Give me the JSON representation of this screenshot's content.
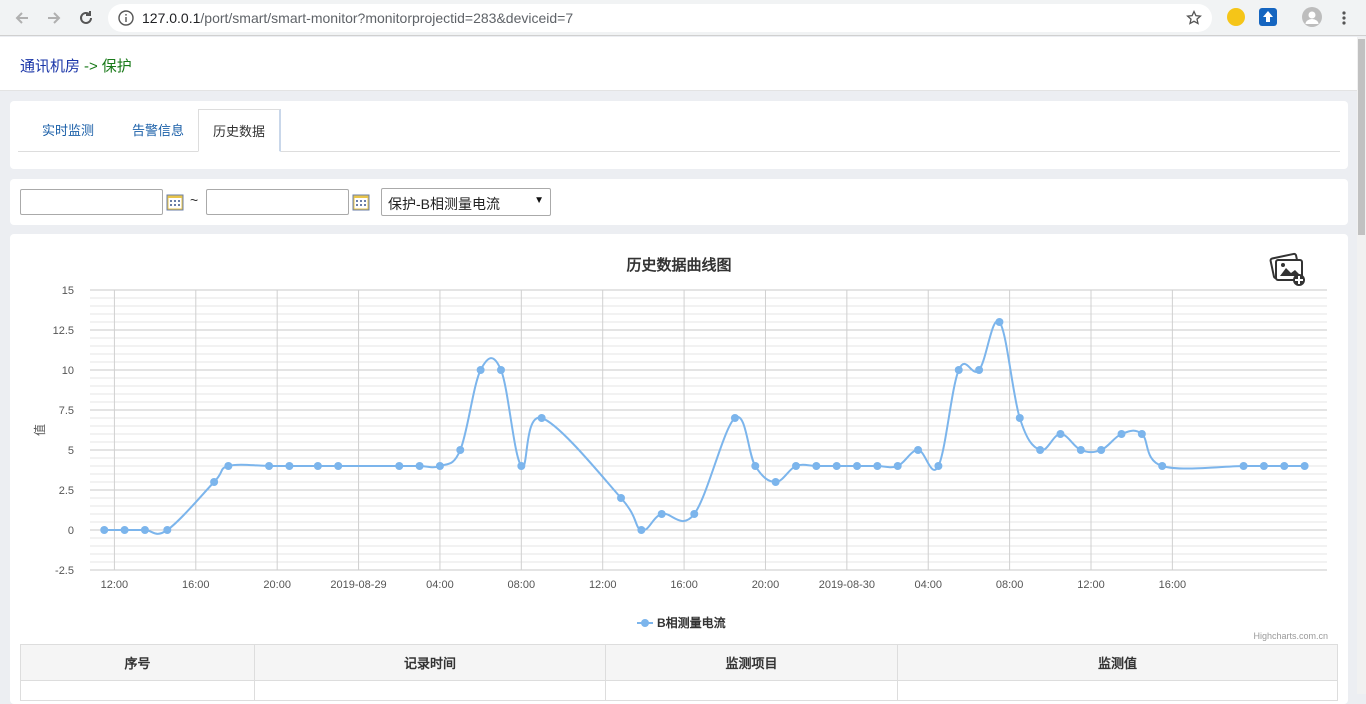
{
  "browser": {
    "url_host": "127.0.0.1",
    "url_path": "/port/smart/smart-monitor?monitorprojectid=283&deviceid=7"
  },
  "breadcrumb": {
    "room": "通讯机房",
    "arrow": "->",
    "device": "保护"
  },
  "tabs": [
    {
      "label": "实时监测"
    },
    {
      "label": "告警信息"
    },
    {
      "label": "历史数据"
    }
  ],
  "filter": {
    "start_value": "",
    "separator": "~",
    "end_value": "",
    "selected_item": "保护-B相测量电流"
  },
  "chart": {
    "credit": "Highcharts.com.cn"
  },
  "chart_data": {
    "type": "line",
    "title": "历史数据曲线图",
    "ylabel": "值",
    "xlabel": "",
    "ylim": [
      -2.5,
      15
    ],
    "yticks": [
      "15",
      "12.5",
      "10",
      "7.5",
      "5",
      "2.5",
      "0",
      "-2.5"
    ],
    "xticks": [
      "12:00",
      "16:00",
      "20:00",
      "2019-08-29",
      "04:00",
      "08:00",
      "12:00",
      "16:00",
      "20:00",
      "2019-08-30",
      "04:00",
      "08:00",
      "12:00",
      "16:00"
    ],
    "grid": true,
    "legend_position": "bottom-center",
    "series": [
      {
        "name": "B相测量电流",
        "color": "#7cb5ec",
        "x_hours": [
          -0.5,
          0.5,
          1.5,
          2.6,
          4.9,
          5.6,
          7.6,
          8.6,
          10,
          11,
          14,
          15,
          16,
          17,
          18,
          19,
          20,
          21,
          24.9,
          25.9,
          26.9,
          28.5,
          30.5,
          31.5,
          32.5,
          33.5,
          34.5,
          35.5,
          36.5,
          37.5,
          38.5,
          39.5,
          40.5,
          41.5,
          42.5,
          43.5,
          44.5,
          45.5,
          46.5,
          47.5,
          48.5,
          49.5,
          50.5,
          51.5,
          55.5,
          56.5,
          57.5,
          58.5
        ],
        "values": [
          0,
          0,
          0,
          0,
          3,
          4,
          4,
          4,
          4,
          4,
          4,
          4,
          4,
          5,
          10,
          10,
          4,
          7,
          2,
          0,
          1,
          1,
          7,
          4,
          3,
          4,
          4,
          4,
          4,
          4,
          4,
          5,
          4,
          10,
          10,
          13,
          7,
          5,
          6,
          5,
          5,
          6,
          6,
          4,
          4,
          4,
          4,
          4
        ]
      }
    ]
  },
  "table": {
    "headers": [
      "序号",
      "记录时间",
      "监测项目",
      "监测值"
    ]
  },
  "colors": {
    "series": "#7cb5ec",
    "link_blue": "#1a5fa8",
    "breadcrumb_green": "#1a7a1a"
  }
}
